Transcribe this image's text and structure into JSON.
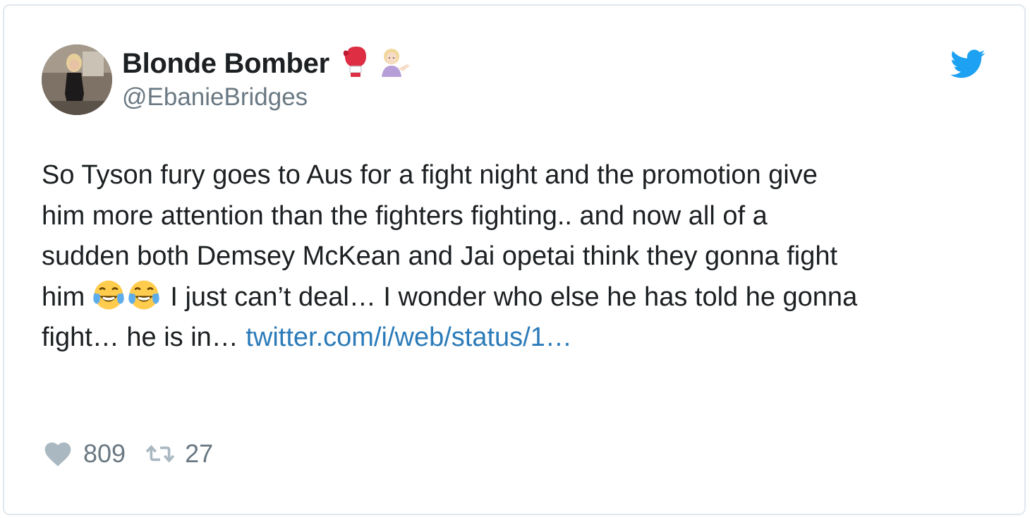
{
  "tweet": {
    "display_name": "Blonde Bomber",
    "name_emoji": [
      "boxing-glove-icon",
      "woman-tipping-hand-icon"
    ],
    "handle": "@EbanieBridges",
    "text_lines": [
      "So Tyson fury goes to Aus for a fight night and the promotion give",
      "him more attention than the fighters fighting.. and now all of a",
      "sudden both Demsey McKean and Jai opetai think they gonna fight"
    ],
    "line4_prefix": "him",
    "line4_emoji": [
      "tears-of-joy-icon",
      "tears-of-joy-icon"
    ],
    "line4_rest": "I just can’t deal… I wonder who else he has told he gonna",
    "line5_text": "fight… he is in…",
    "link_text": "twitter.com/i/web/status/1…",
    "likes": "809",
    "retweets": "27"
  },
  "icons": {
    "brand": "twitter-bird-icon",
    "like": "heart-icon",
    "retweet": "retweet-icon"
  },
  "colors": {
    "twitter_blue": "#1da1f2",
    "link": "#2b7bb9",
    "secondary_text": "#697882",
    "action_icon": "#aab8c2"
  }
}
